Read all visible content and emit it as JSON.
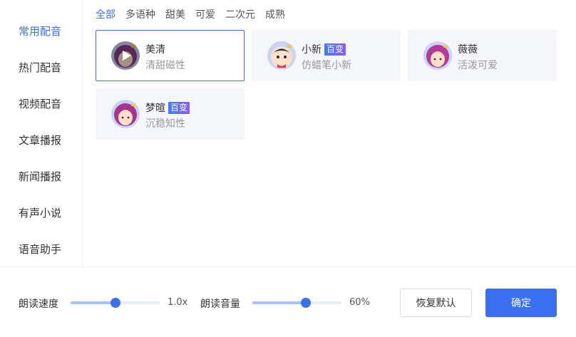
{
  "sidebar": {
    "items": [
      {
        "label": "常用配音",
        "active": true
      },
      {
        "label": "热门配音",
        "active": false
      },
      {
        "label": "视频配音",
        "active": false
      },
      {
        "label": "文章播报",
        "active": false
      },
      {
        "label": "新闻播报",
        "active": false
      },
      {
        "label": "有声小说",
        "active": false
      },
      {
        "label": "语音助手",
        "active": false
      }
    ]
  },
  "filters": [
    {
      "label": "全部",
      "active": true
    },
    {
      "label": "多语种",
      "active": false
    },
    {
      "label": "甜美",
      "active": false
    },
    {
      "label": "可爱",
      "active": false
    },
    {
      "label": "二次元",
      "active": false
    },
    {
      "label": "成熟",
      "active": false
    }
  ],
  "voices": [
    {
      "name": "美清",
      "desc": "清甜磁性",
      "badge": "",
      "selected": true,
      "avatar_icon": "female-avatar-icon"
    },
    {
      "name": "小新",
      "desc": "仿蜡笔小新",
      "badge": "百变",
      "selected": false,
      "avatar_icon": "boy-avatar-icon"
    },
    {
      "name": "薇薇",
      "desc": "活泼可爱",
      "badge": "",
      "selected": false,
      "avatar_icon": "female-avatar-icon"
    },
    {
      "name": "梦暄",
      "desc": "沉稳知性",
      "badge": "百变",
      "selected": false,
      "avatar_icon": "female-avatar-icon"
    }
  ],
  "controls": {
    "speed": {
      "label": "朗读速度",
      "value_text": "1.0x",
      "level": 0.5
    },
    "volume": {
      "label": "朗读音量",
      "value_text": "60%",
      "level": 0.6
    }
  },
  "buttons": {
    "reset": "恢复默认",
    "confirm": "确定"
  },
  "colors": {
    "accent": "#3a6ff0",
    "card_bg": "#f5f6fa",
    "badge_from": "#3b7bff",
    "badge_to": "#8c5cf6"
  }
}
